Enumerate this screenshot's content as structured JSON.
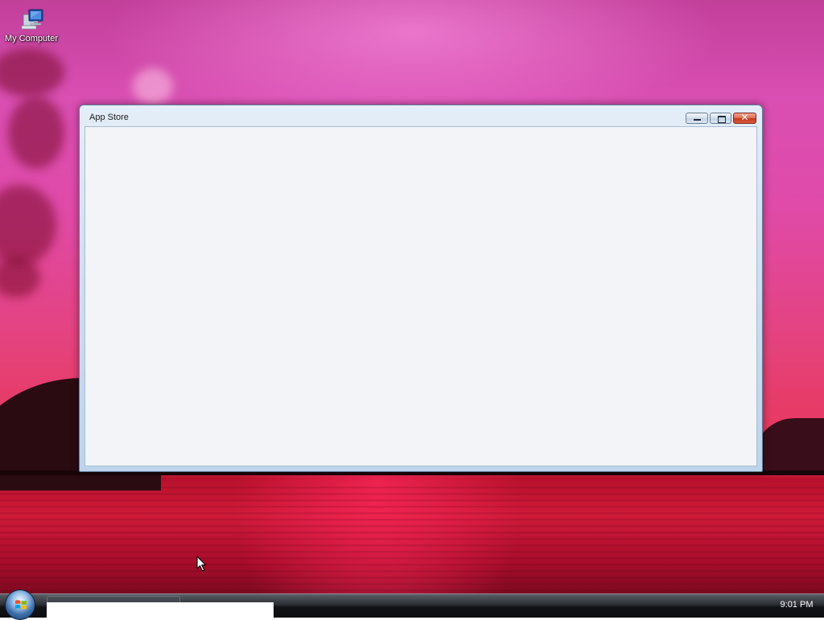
{
  "desktop": {
    "icons": [
      {
        "label": "My Computer",
        "icon": "computer-icon"
      }
    ]
  },
  "window": {
    "title": "App Store",
    "controls": {
      "minimize_icon": "minimize-icon",
      "maximize_icon": "maximize-icon",
      "close_glyph": "✕"
    }
  },
  "taskbar": {
    "start_icon": "windows-start-orb",
    "clock": "9:01 PM"
  },
  "colors": {
    "window_client": "#f2f4f7",
    "close_button": "#d7583c",
    "taskbar": "#111316"
  }
}
